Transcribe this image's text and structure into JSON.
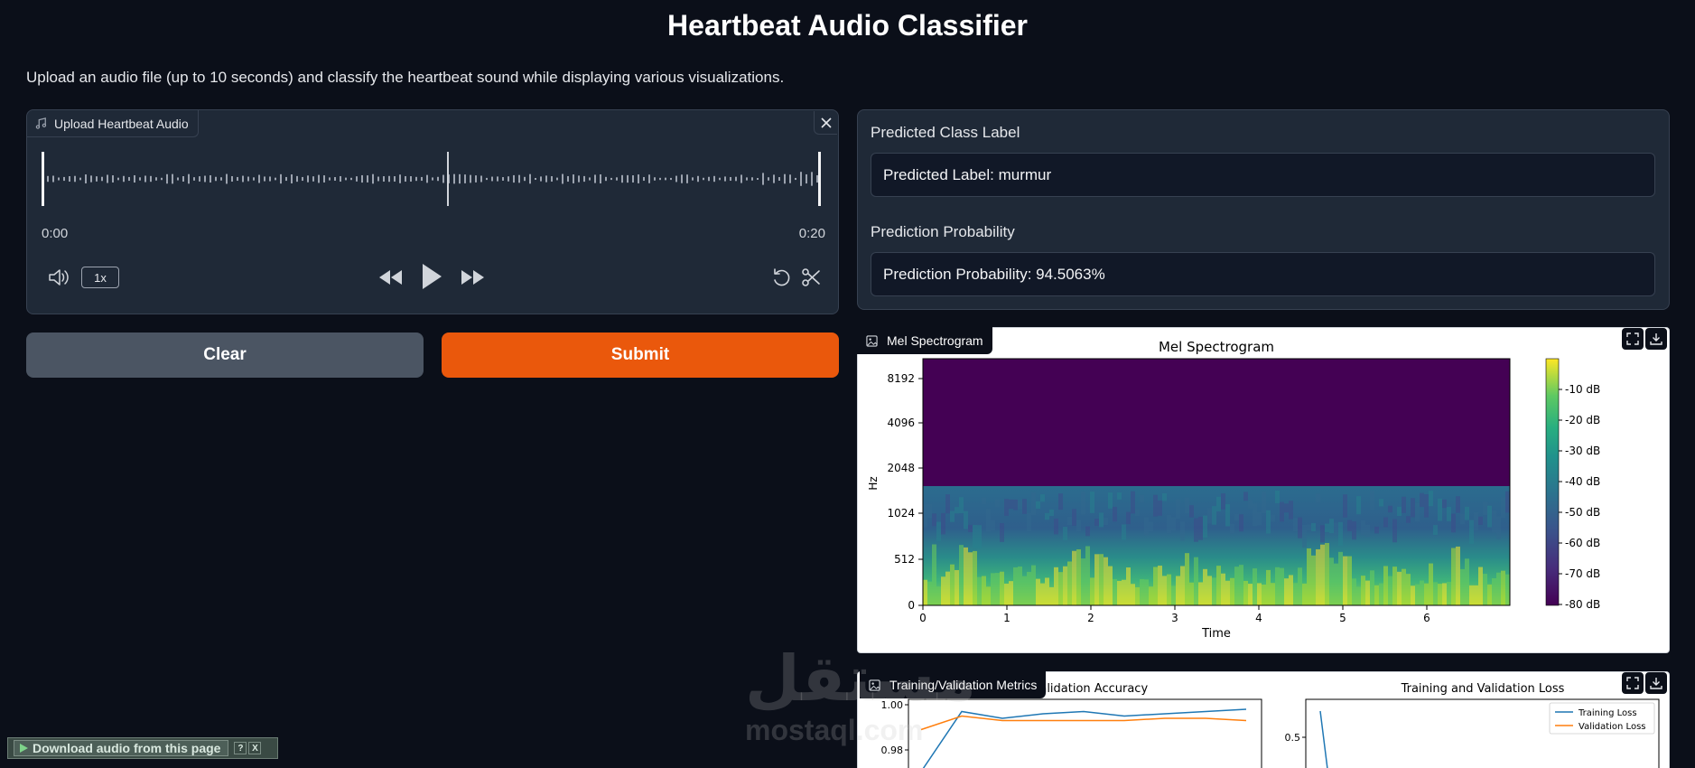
{
  "page": {
    "title": "Heartbeat Audio Classifier",
    "description": "Upload an audio file (up to 10 seconds) and classify the heartbeat sound while displaying various visualizations."
  },
  "audio": {
    "label": "Upload Heartbeat Audio",
    "time_start": "0:00",
    "time_end": "0:20",
    "speed": "1x"
  },
  "buttons": {
    "clear": "Clear",
    "submit": "Submit"
  },
  "prediction": {
    "label_heading": "Predicted Class Label",
    "label_value": "Predicted Label: murmur",
    "prob_heading": "Prediction Probability",
    "prob_value": "Prediction Probability: 94.5063%"
  },
  "spectrogram": {
    "panel_label": "Mel Spectrogram",
    "title": "Mel Spectrogram",
    "xlabel": "Time",
    "ylabel": "Hz",
    "y_ticks": [
      "8192",
      "4096",
      "2048",
      "1024",
      "512",
      "0"
    ],
    "x_ticks": [
      "0",
      "1",
      "2",
      "3",
      "4",
      "5",
      "6"
    ],
    "colorbar_ticks": [
      "-10 dB",
      "-20 dB",
      "-30 dB",
      "-40 dB",
      "-50 dB",
      "-60 dB",
      "-70 dB",
      "-80 dB"
    ]
  },
  "metrics": {
    "panel_label": "Training/Validation Metrics",
    "acc_title_visible": "nd Validation Accuracy",
    "loss_title": "Training and Validation Loss",
    "acc_y_ticks": [
      "1.00",
      "0.98"
    ],
    "loss_y_ticks": [
      "0.5"
    ],
    "legend": [
      "Training Loss",
      "Validation Loss"
    ]
  },
  "chart_data": [
    {
      "type": "line",
      "title": "Training and Validation Accuracy",
      "series": [
        {
          "name": "",
          "color": "#1f77b4",
          "values": [
            0.92,
            0.997,
            0.994,
            0.996,
            0.997,
            0.995,
            0.996,
            0.997,
            0.998
          ]
        },
        {
          "name": "",
          "color": "#ff7f0e",
          "values": [
            0.989,
            0.995,
            0.993,
            0.993,
            0.993,
            0.993,
            0.994,
            0.994,
            0.993
          ]
        }
      ],
      "ylim": [
        0.96,
        1.0
      ]
    },
    {
      "type": "line",
      "title": "Training and Validation Loss",
      "series": [
        {
          "name": "Training Loss",
          "color": "#1f77b4",
          "values": [
            0.6,
            0.1
          ]
        },
        {
          "name": "Validation Loss",
          "color": "#ff7f0e",
          "values": []
        }
      ]
    }
  ],
  "download_bar": {
    "label": "Download audio from this page",
    "help": "?",
    "close": "X"
  },
  "watermark": {
    "arabic": "مستقل",
    "latin": "mostaql.com"
  }
}
